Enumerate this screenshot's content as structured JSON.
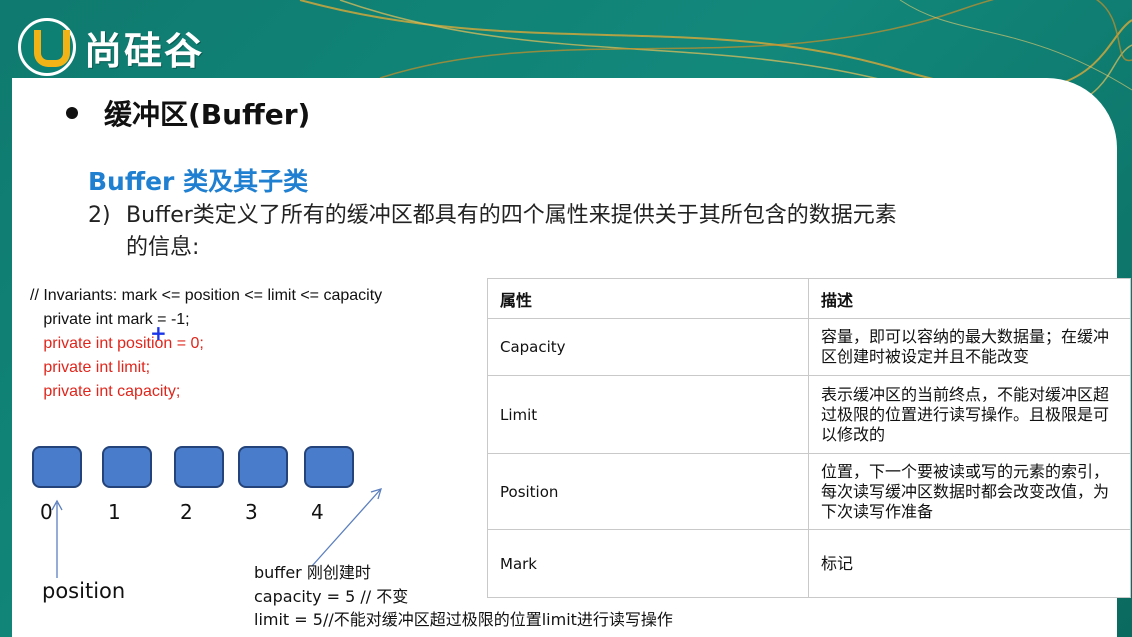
{
  "logo": {
    "text": "尚硅谷"
  },
  "slide": {
    "title": "缓冲区(Buffer)",
    "subtitle": "Buffer 类及其子类",
    "point_number": "2)",
    "point_line1": "Buffer类定义了所有的缓冲区都具有的四个属性来提供关于其所包含的数据元素",
    "point_line2": "的信息:"
  },
  "code": {
    "comment": "// Invariants: mark <= position <= limit <= capacity",
    "line_mark": "   private int mark = -1;",
    "line_position": "   private int position = 0;",
    "line_limit": "   private int limit;",
    "line_capacity": "   private int capacity;"
  },
  "buffer_diagram": {
    "indices": [
      "0",
      "1",
      "2",
      "3",
      "4"
    ],
    "position_label": "position",
    "caption_line1": "buffer 刚创建时",
    "caption_line2": "capacity = 5 // 不变",
    "caption_line3": "limit = 5//不能对缓冲区超过极限的位置limit进行读写操作"
  },
  "table": {
    "header_property": "属性",
    "header_description": "描述",
    "rows": [
      {
        "property": "Capacity",
        "description": "容量，即可以容纳的最大数据量；在缓冲区创建时被设定并且不能改变"
      },
      {
        "property": "Limit",
        "description": "表示缓冲区的当前终点，不能对缓冲区超过极限的位置进行读写操作。且极限是可以修改的"
      },
      {
        "property": "Position",
        "description": "位置，下一个要被读或写的元素的索引，每次读写缓冲区数据时都会改变改值，为下次读写作准备"
      },
      {
        "property": "Mark",
        "description": "标记"
      }
    ]
  },
  "colors": {
    "frame": "#0f7a6f",
    "accent_blue": "#1f7fd0",
    "code_red": "#e0261c",
    "box_fill": "#4a7ccc",
    "logo_yellow": "#f2b316"
  }
}
